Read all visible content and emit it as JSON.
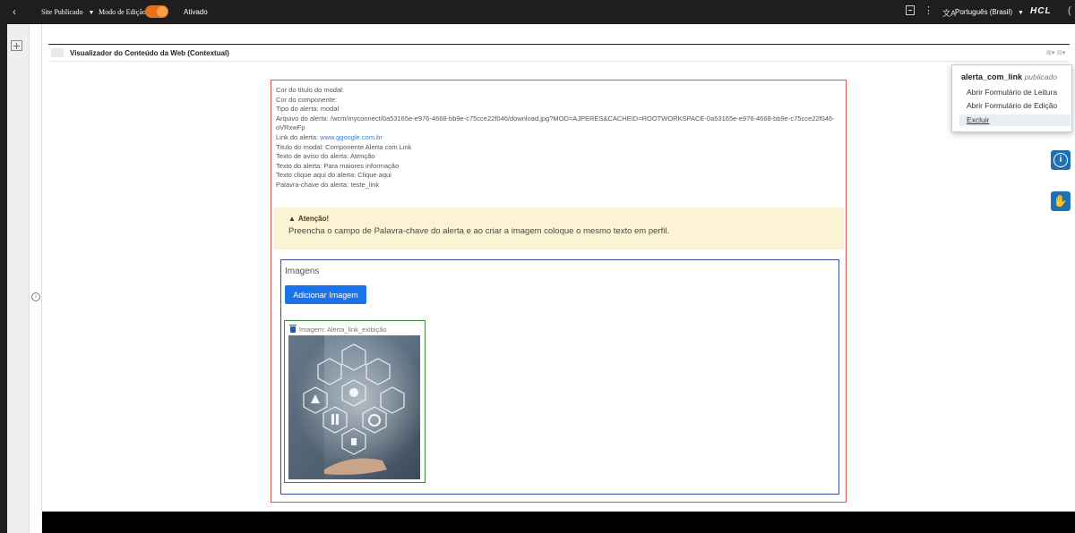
{
  "toolbar": {
    "back_icon": "chevron-left-icon",
    "site_label": "Site Publicado",
    "edit_mode_label": "Modo de Edição:",
    "edit_mode_state": "Ativado",
    "toggle_color": "#e5701f",
    "language": "Português (Brasil)",
    "brand": "HCL"
  },
  "portlet": {
    "title": "Visualizador do Conteúdo da Web (Contextual)"
  },
  "menu": {
    "item_name": "alerta_com_link",
    "status": "publicado",
    "items": [
      "Abrir Formulário de Leitura",
      "Abrir Formulário de Edição",
      "Excluir"
    ],
    "selected": "Excluir"
  },
  "content": {
    "lines": [
      "Cor do título do modal:",
      "Cor do componente:",
      "Tipo do alerta: modal"
    ],
    "file_label": "Arquivo do alerta: ",
    "file_value": "/wcm/myconnect/0a53165e-e976-4668-bb9e-c75cce22f046/download.jpg?MOD=AJPERES&CACHEID=ROOTWORKSPACE-0a53165e-e976-4668-bb9e-c75cce22f046-oVRxwFp",
    "link_label": "Link do alerta: ",
    "link_value": "www.ggoogle.com.br",
    "lines_after": [
      "Titulo do modal: Componente Alerta com Link",
      "Texto de aviso do alerta: Atenção",
      "Texto do alerta: Para maiores informação",
      "Texto clique aqui do alerta: Clique aqui",
      "Palavra-chave do alerta: teste_link"
    ]
  },
  "warning": {
    "title": "Atenção!",
    "text": "Preencha o campo de Palavra-chave do alerta e ao criar a imagem coloque o mesmo texto em perfil.",
    "bg_color": "#fcf3d4"
  },
  "images": {
    "section_label": "Imagens",
    "add_button": "Adicionar Imagem",
    "item_caption": "Imagem: Alerta_link_exibição"
  }
}
